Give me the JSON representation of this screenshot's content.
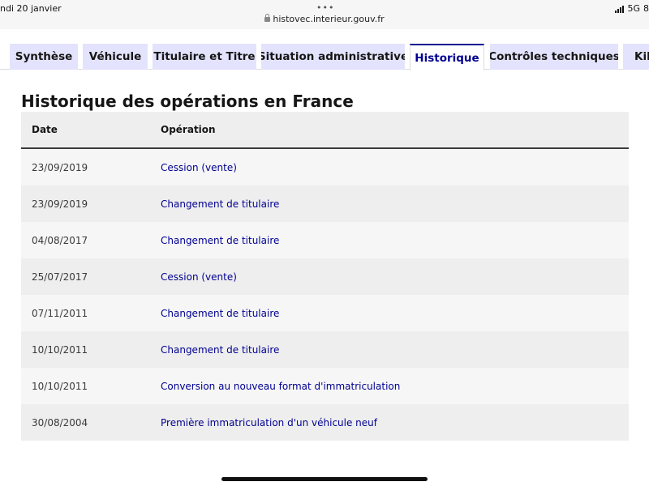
{
  "status_bar": {
    "time": "ndi 20 janvier",
    "network": "5G",
    "battery": "8",
    "url": "histovec.interieur.gouv.fr"
  },
  "tabs": [
    {
      "label": "Synthèse"
    },
    {
      "label": "Véhicule"
    },
    {
      "label": "Titulaire et Titre"
    },
    {
      "label": "Situation administrative"
    },
    {
      "label": "Historique"
    },
    {
      "label": "Contrôles techniques"
    },
    {
      "label": "Kil"
    }
  ],
  "active_tab": "Historique",
  "section": {
    "title": "Historique des opérations en France",
    "columns": {
      "date": "Date",
      "operation": "Opération"
    },
    "rows": [
      {
        "date": "23/09/2019",
        "operation": "Cession (vente)"
      },
      {
        "date": "23/09/2019",
        "operation": "Changement de titulaire"
      },
      {
        "date": "04/08/2017",
        "operation": "Changement de titulaire"
      },
      {
        "date": "25/07/2017",
        "operation": "Cession (vente)"
      },
      {
        "date": "07/11/2011",
        "operation": "Changement de titulaire"
      },
      {
        "date": "10/10/2011",
        "operation": "Changement de titulaire"
      },
      {
        "date": "10/10/2011",
        "operation": "Conversion au nouveau format d'immatriculation"
      },
      {
        "date": "30/08/2004",
        "operation": "Première immatriculation d'un véhicule neuf"
      }
    ]
  },
  "colors": {
    "accent": "#000091",
    "tab_bg": "#e3e3fd",
    "row_light": "#f6f6f6",
    "row_dark": "#eeeeee"
  }
}
